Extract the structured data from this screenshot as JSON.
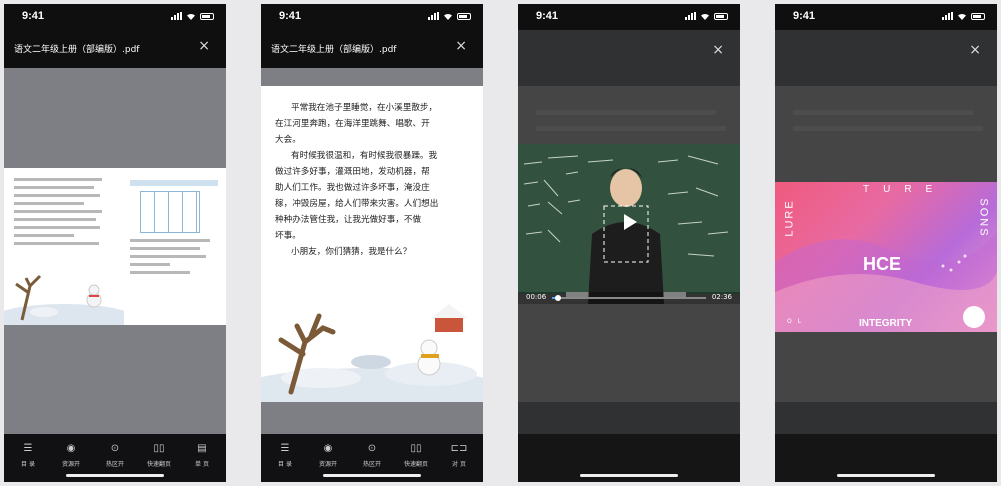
{
  "status": {
    "time": "9:41"
  },
  "doc": {
    "title": "语文二年级上册（部编版）.pdf",
    "close": "×"
  },
  "toolbar1": [
    {
      "label": "目 录",
      "icon": "list-icon"
    },
    {
      "label": "资源开",
      "icon": "eye-icon"
    },
    {
      "label": "热区开",
      "icon": "hotspot-icon"
    },
    {
      "label": "快速翻页",
      "icon": "book-icon"
    },
    {
      "label": "单 页",
      "icon": "page-icon"
    }
  ],
  "toolbar2": [
    {
      "label": "目 录",
      "icon": "list-icon"
    },
    {
      "label": "资源开",
      "icon": "eye-icon"
    },
    {
      "label": "热区开",
      "icon": "hotspot-icon"
    },
    {
      "label": "快速翻页",
      "icon": "book-icon"
    },
    {
      "label": "对 页",
      "icon": "spread-icon"
    }
  ],
  "textbook": {
    "lines": [
      "平常我在池子里睡觉，在小溪里散步，",
      "在江河里奔跑，在海洋里跳舞、唱歌、开",
      "大会。",
      "有时候我很温和，有时候我很暴躁。我",
      "做过许多好事，灌溉田地，发动机器，帮",
      "助人们工作。我也做过许多坏事，淹没庄",
      "稼，冲毁房屋，给人们带来灾害。人们想出",
      "种种办法管住我，让我光做好事，不做",
      "坏事。",
      "小朋友，你们猜猜，我是什么？"
    ]
  },
  "video": {
    "elapsed": "00:06",
    "duration": "02:36",
    "progress": 0.04
  },
  "animation": {
    "left_word": "LURE",
    "top_word": "TURE",
    "right_word": "SONS",
    "bottom_word": "INTEGRITY",
    "small_left": "OL",
    "logo": "HCE"
  },
  "colors": {
    "accent": "#4da3ff",
    "bar": "#111113",
    "page_bg": "#7d7f84"
  }
}
